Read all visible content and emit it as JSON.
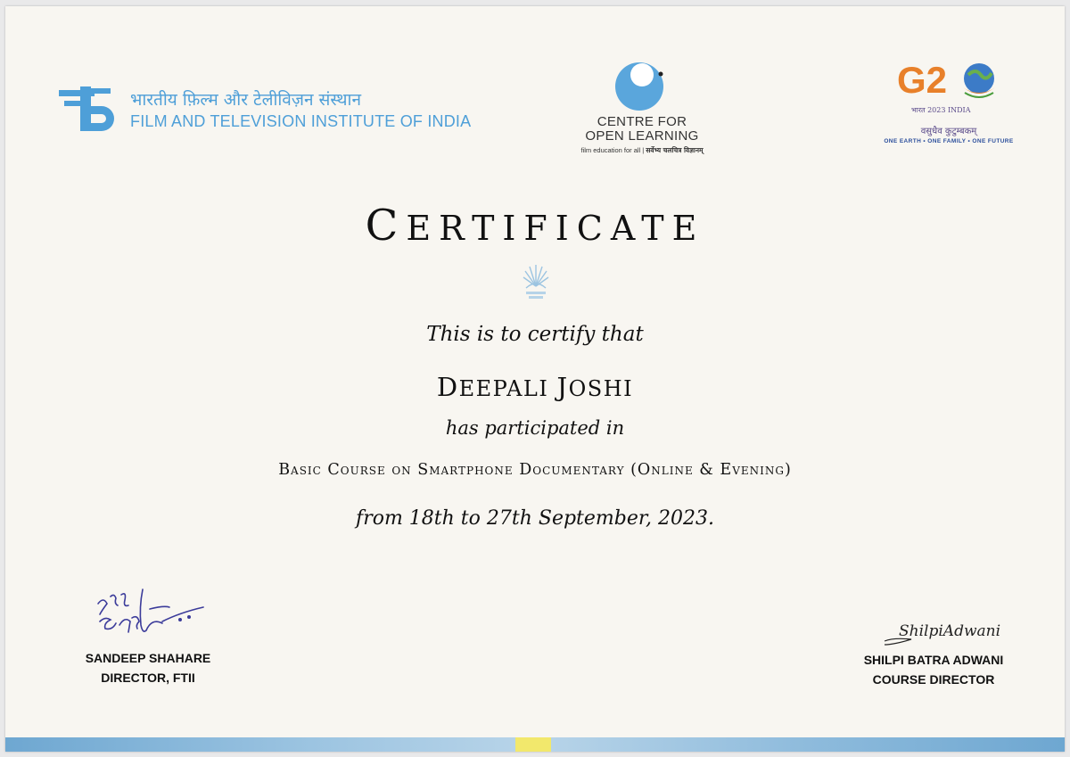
{
  "logos": {
    "ftii": {
      "hindi": "भारतीय फ़िल्म और टेलीविज़न संस्थान",
      "english": "FILM AND TELEVISION INSTITUTE OF INDIA"
    },
    "col": {
      "line1": "CENTRE FOR",
      "line2": "OPEN LEARNING",
      "tagline_en": "film education for all",
      "tagline_hi": "सर्वेभ्य चलचित्र विज्ञानम्"
    },
    "g20": {
      "mark_text": "G2",
      "sub": "भारत 2023 INDIA",
      "sanskrit": "वसुधैव कुटुम्बकम्",
      "motto": "ONE EARTH • ONE FAMILY • ONE FUTURE"
    }
  },
  "certificate": {
    "title_first": "C",
    "title_rest": "ERTIFICATE",
    "certify_line": "This is to certify that",
    "name_first": "D",
    "name_mid": "EEPALI ",
    "name_j": "J",
    "name_rest": "OSHI",
    "participated_line": "has participated in",
    "course_text": "Basic Course on Smartphone Documentary (Online & Evening)",
    "date_line": "from 18th to 27th September, 2023."
  },
  "signatories": {
    "left": {
      "name": "SANDEEP SHAHARE",
      "title": "DIRECTOR, FTII"
    },
    "right": {
      "name": "SHILPI BATRA ADWANI",
      "title": "COURSE DIRECTOR",
      "signature_text": "ShilpiAdwani"
    }
  },
  "colors": {
    "ftii_blue": "#4e9fd8",
    "col_blue": "#5aa6dc",
    "band_yellow": "#f2e86c",
    "paper": "#f8f6f1"
  }
}
